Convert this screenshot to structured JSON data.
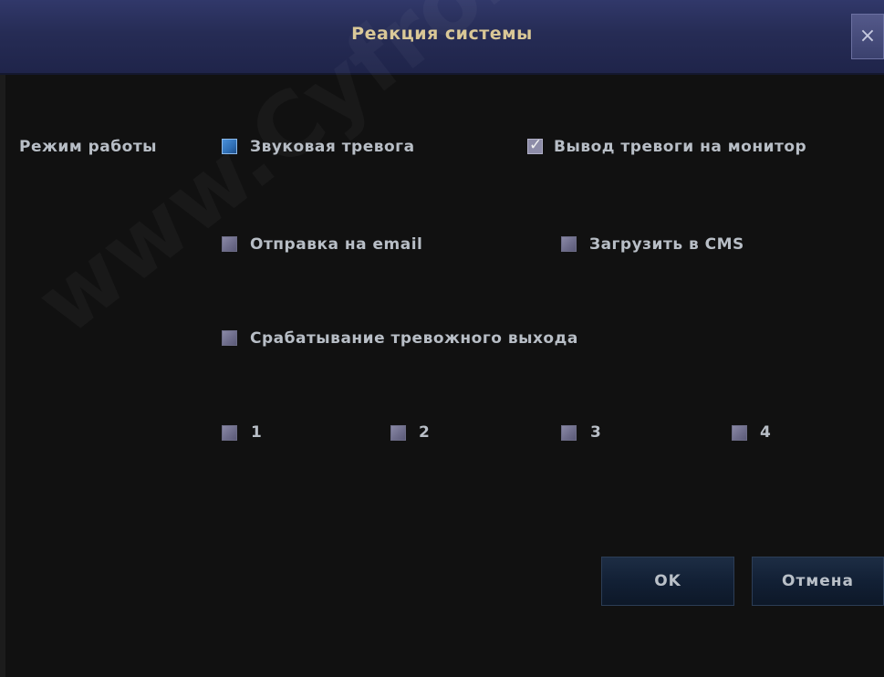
{
  "dialog": {
    "title": "Реакция системы",
    "close_label": "×"
  },
  "section_label": "Режим работы",
  "options": {
    "sound_alarm": {
      "label": "Звуковая тревога",
      "checked": false
    },
    "show_on_monitor": {
      "label": "Вывод тревоги на монитор",
      "checked": true
    },
    "send_email": {
      "label": "Отправка на email",
      "checked": false
    },
    "upload_cms": {
      "label": "Загрузить в CMS",
      "checked": false
    },
    "alarm_output": {
      "label": "Срабатывание тревожного выхода",
      "checked": false
    }
  },
  "outputs": [
    {
      "label": "1",
      "checked": false
    },
    {
      "label": "2",
      "checked": false
    },
    {
      "label": "3",
      "checked": false
    },
    {
      "label": "4",
      "checked": false
    }
  ],
  "buttons": {
    "ok": "OK",
    "cancel": "Отмена"
  },
  "watermark": "www.Cyfron.ru",
  "colors": {
    "titlebar": "#2a3060",
    "title_text": "#d9c796",
    "background": "#121212",
    "checkbox_focus": "#2f6fb5"
  }
}
